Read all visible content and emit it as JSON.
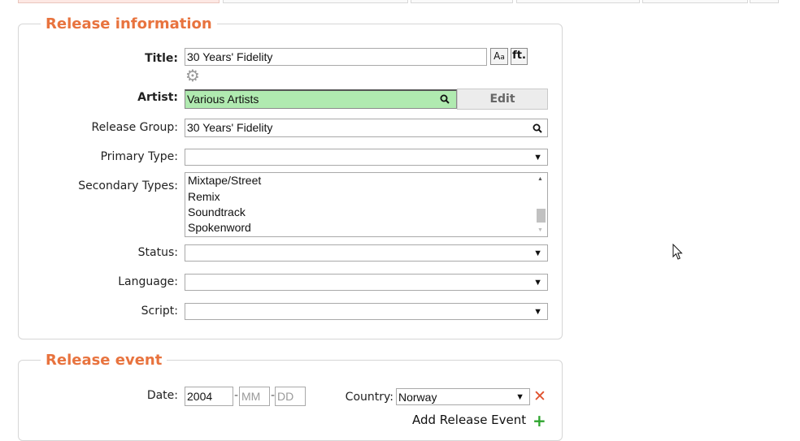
{
  "release_information": {
    "legend": "Release information",
    "title_label": "Title:",
    "title_value": "30 Years' Fidelity",
    "guess_case_icon": "guess-case-icon",
    "ft_label": "ft.",
    "options_icon": "gear-icon",
    "artist_label": "Artist:",
    "artist_value": "Various Artists",
    "artist_edit_label": "Edit",
    "release_group_label": "Release Group:",
    "release_group_value": "30 Years' Fidelity",
    "primary_type_label": "Primary Type:",
    "primary_type_value": "",
    "secondary_types_label": "Secondary Types:",
    "secondary_types_options": [
      "Mixtape/Street",
      "Remix",
      "Soundtrack",
      "Spokenword"
    ],
    "status_label": "Status:",
    "status_value": "",
    "language_label": "Language:",
    "language_value": "",
    "script_label": "Script:",
    "script_value": ""
  },
  "release_event": {
    "legend": "Release event",
    "date_label": "Date:",
    "year_value": "2004",
    "month_placeholder": "MM",
    "day_placeholder": "DD",
    "country_label": "Country:",
    "country_value": "Norway",
    "add_label": "Add Release Event"
  },
  "colors": {
    "legend": "#e8733e",
    "artist_field_bg": "#b0eab0",
    "remove_icon": "#e0522e",
    "add_icon": "#2fa52f"
  }
}
